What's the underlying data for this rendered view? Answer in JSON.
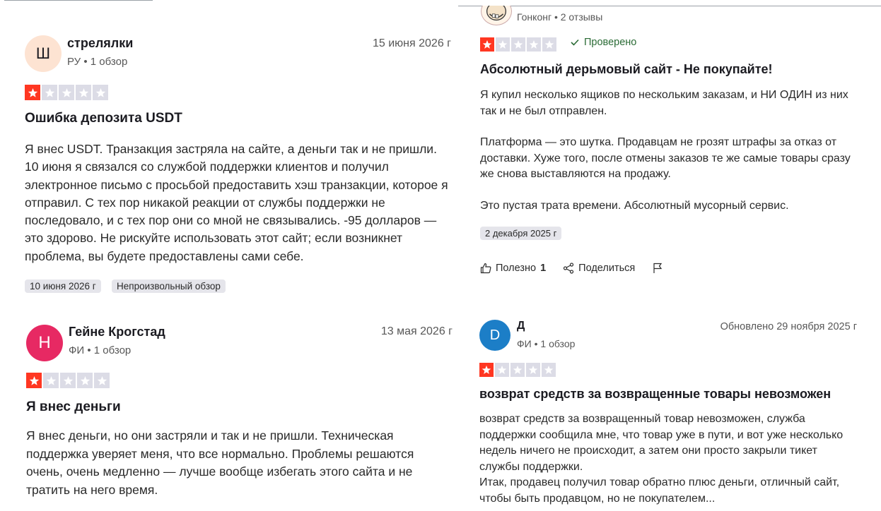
{
  "colors": {
    "star_filled": "#ff3722",
    "star_empty": "#dcdce6",
    "verified": "#2a6b35"
  },
  "reviews": [
    {
      "avatar_letter": "Ш",
      "name": "стрелялки",
      "meta": "РУ • 1 обзор",
      "date": "15 июня 2026 г",
      "rating": 1,
      "title": "Ошибка депозита USDT",
      "body": "Я внес USDT. Транзакция застряла на сайте, а деньги так и не пришли. 10 июня я связался со службой поддержки клиентов и получил электронное письмо с просьбой предоставить хэш транзакции, которое я отправил. С тех пор никакой реакции от службы поддержки не последовало, и с тех пор они со мной не связывались. -95 долларов — это здорово. Не рискуйте использовать этот сайт; если возникнет проблема, вы будете предоставлены сами себе.",
      "tags": [
        "10 июня 2026 г",
        "Непроизвольный обзор"
      ]
    },
    {
      "avatar_letter": "",
      "avatar_icon": "face-avatar-icon",
      "name": "",
      "meta": "Гонконг • 2 отзывы",
      "date": "",
      "rating": 1,
      "verified": "Проверено",
      "title": "Абсолютный дерьмовый сайт - Не покупайте!",
      "paragraphs": [
        "Я купил несколько ящиков по нескольким заказам, и НИ ОДИН из них так и не был отправлен.",
        "Платформа — это шутка. Продавцам не грозят штрафы за отказ от доставки. Хуже того, после отмены заказов те же самые товары сразу же снова выставляются на продажу.",
        "Это пустая трата времени. Абсолютный мусорный сервис."
      ],
      "tags": [
        "2 декабря 2025 г"
      ],
      "actions": {
        "helpful": "Полезно",
        "helpful_count": "1",
        "share": "Поделиться"
      }
    },
    {
      "avatar_letter": "Н",
      "name": "Гейне Крогстад",
      "meta": "ФИ • 1 обзор",
      "date": "13 мая 2026 г",
      "rating": 1,
      "title": "Я внес деньги",
      "body": "Я внес деньги, но они застряли и так и не пришли. Техническая поддержка уверяет меня, что все нормально. Проблемы решаются очень, очень медленно — лучше вообще избегать этого сайта и не тратить на него время."
    },
    {
      "avatar_letter": "D",
      "name": "Д",
      "meta": "ФИ • 1 обзор",
      "date": "Обновлено 29 ноября 2025 г",
      "rating": 1,
      "title": "возврат средств за возвращенные товары невозможен",
      "lines": [
        "возврат средств за возвращенный товар невозможен, служба поддержки сообщила мне, что товар уже в пути, и вот уже несколько недель ничего не происходит, а затем они просто закрыли тикет службы поддержки.",
        "Итак, продавец получил товар обратно плюс деньги, отличный сайт, чтобы быть продавцом, но не покупателем..."
      ]
    }
  ]
}
